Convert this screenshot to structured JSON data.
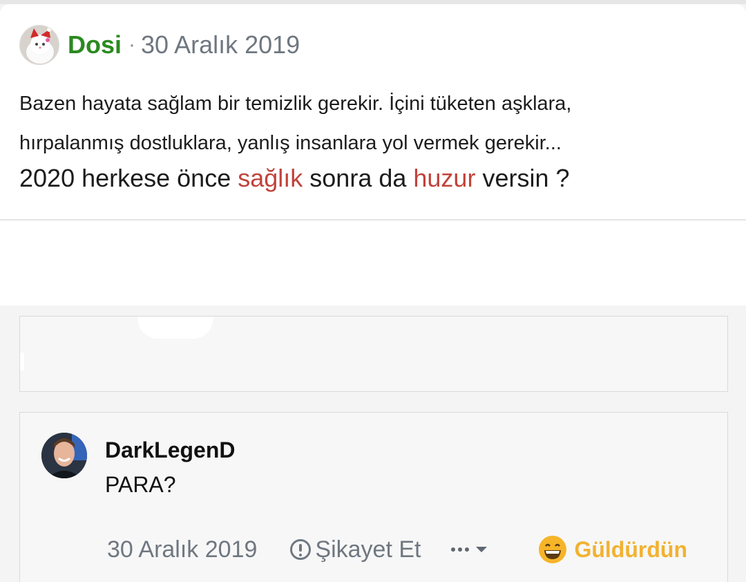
{
  "post": {
    "author": "Dosi",
    "separator": "·",
    "date": "30 Aralık 2019",
    "line1": "Bazen hayata sağlam bir temizlik gerekir. İçini tüketen aşklara,",
    "line2": "hırpalanmış dostluklara, yanlış insanlara yol vermek gerekir...",
    "line3": {
      "part1": "2020 herkese önce ",
      "highlight1": "sağlık",
      "part2": " sonra da ",
      "highlight2": "huzur",
      "part3": " versin ?"
    },
    "highlight_color": "#c0433b",
    "author_color": "#2a8a1f"
  },
  "comment": {
    "author": "DarkLegenD",
    "text": "PARA?",
    "date": "30 Aralık 2019",
    "report_label": "Şikayet Et",
    "reaction_label": "Güldürdün",
    "reaction_color": "#f2b230"
  },
  "icons": {
    "author_avatar": "cat-avatar",
    "commenter_avatar": "user-avatar",
    "report": "exclamation-circle-icon",
    "more": "more-dots-icon",
    "caret": "chevron-down-icon",
    "reaction": "grinning-face-icon"
  }
}
